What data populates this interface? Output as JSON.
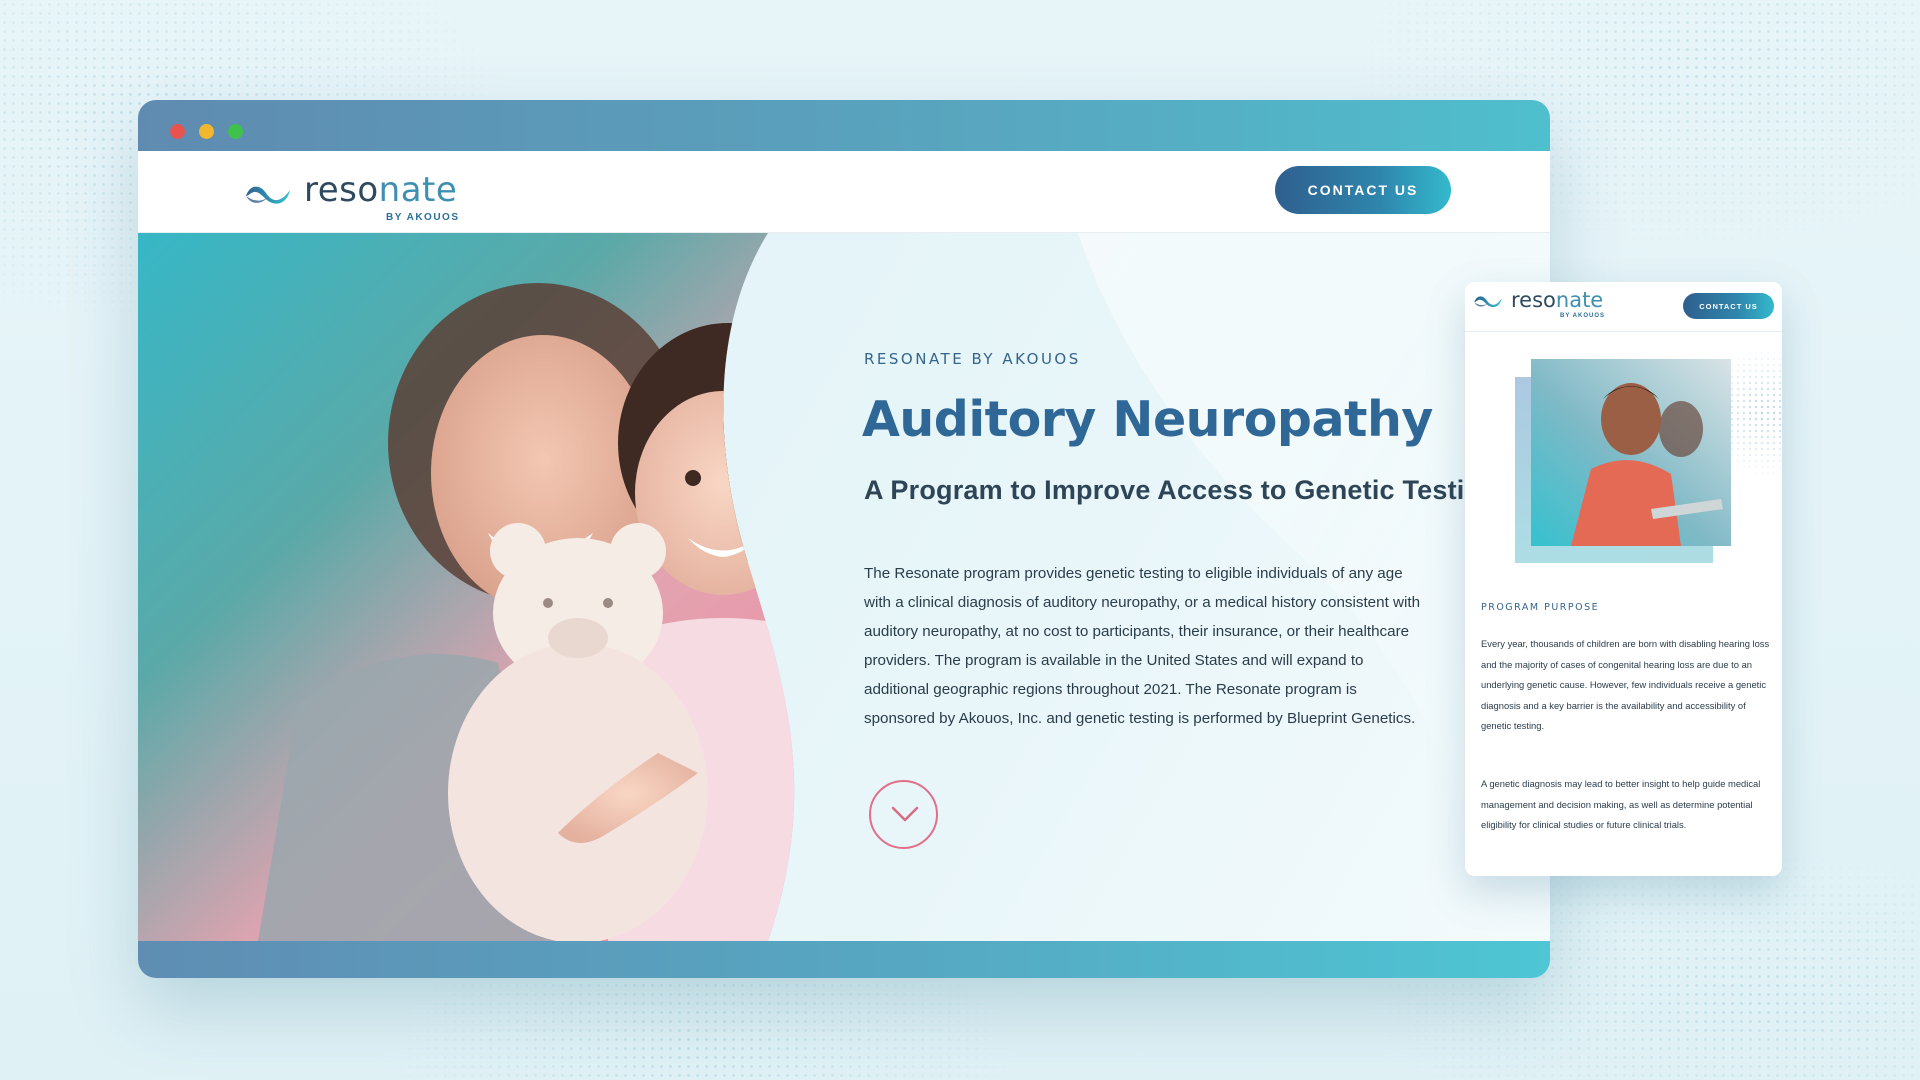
{
  "browser": {
    "window_controls": [
      "close",
      "minimize",
      "maximize"
    ]
  },
  "site": {
    "logo": {
      "word_plain": "reso",
      "word_accent": "nate",
      "sub": "BY AKOUOS"
    },
    "contact_label": "CONTACT US"
  },
  "hero": {
    "eyebrow": "RESONATE BY AKOUOS",
    "title": "Auditory Neuropathy",
    "subtitle": "A Program to Improve Access to Genetic Testing",
    "body": "The Resonate program provides genetic testing to eligible individuals of any age with a clinical diagnosis of auditory neuropathy, or a medical history consistent with auditory neuropathy, at no cost to participants, their insurance, or their healthcare providers. The program is available in the United States and will expand to additional geographic regions throughout 2021. The Resonate program is sponsored by Akouos, Inc. and genetic testing is performed by Blueprint Genetics.",
    "scroll_icon": "chevron-down-icon",
    "photo_alt": "Smiling mother hugging her young daughter holding a teddy bear"
  },
  "mobile": {
    "logo": {
      "word_plain": "reso",
      "word_accent": "nate",
      "sub": "BY AKOUOS"
    },
    "contact_label": "CONTACT US",
    "eyebrow": "PROGRAM PURPOSE",
    "paragraphs": [
      "Every year, thousands of children are born with disabling hearing loss and the majority of cases of congenital hearing loss are due to an underlying genetic cause. However, few individuals receive a genetic diagnosis and a key barrier is the availability and accessibility of genetic testing.",
      "A genetic diagnosis may lead to better insight to help guide medical management and decision making, as well as determine potential eligibility for clinical studies or future clinical trials."
    ],
    "photo_alt": "Smiling woman working at a laptop"
  },
  "colors": {
    "brand_blue": "#2f6796",
    "brand_teal": "#33b9cc",
    "accent_pink": "#e26f89",
    "text_dark": "#2a3d4b"
  }
}
